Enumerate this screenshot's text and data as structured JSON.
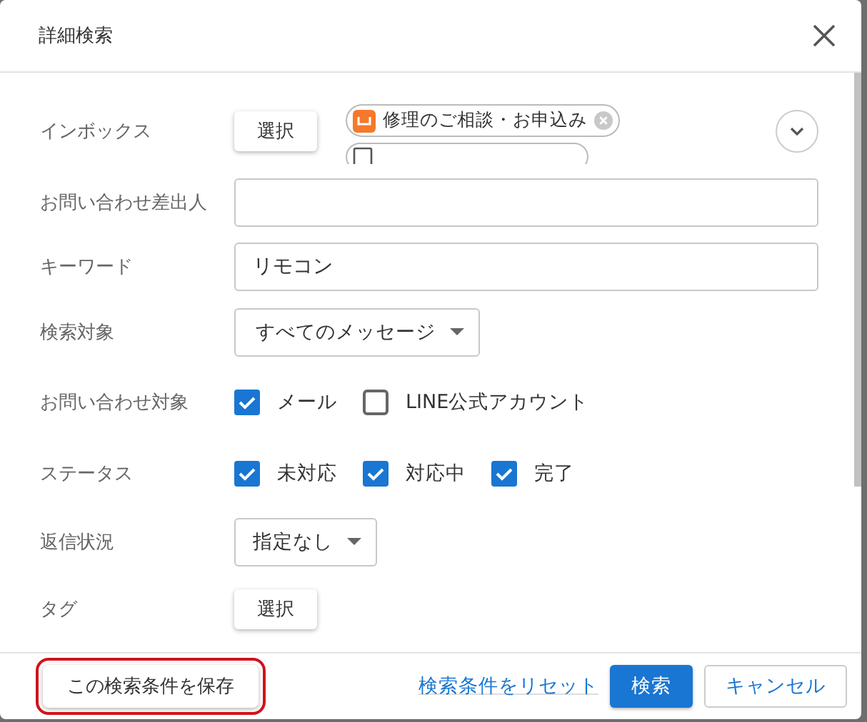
{
  "dialog": {
    "title": "詳細検索"
  },
  "inbox": {
    "label": "インボックス",
    "button": "選択",
    "chips": [
      {
        "label": "修理のご相談・お申込み",
        "kind": "orange"
      },
      {
        "kind": "clipped"
      }
    ],
    "expanded": false
  },
  "sender": {
    "label": "お問い合わせ差出人"
  },
  "keyword": {
    "label": "キーワード",
    "value": "リモコン"
  },
  "target": {
    "label": "検索対象",
    "value": "すべてのメッセージ"
  },
  "channel": {
    "label": "お問い合わせ対象",
    "options": [
      {
        "label": "メール",
        "checked": true
      },
      {
        "label": "LINE公式アカウント",
        "checked": false
      }
    ]
  },
  "status": {
    "label": "ステータス",
    "options": [
      {
        "label": "未対応",
        "checked": true
      },
      {
        "label": "対応中",
        "checked": true
      },
      {
        "label": "完了",
        "checked": true
      }
    ]
  },
  "reply": {
    "label": "返信状況",
    "value": "指定なし"
  },
  "tag": {
    "label": "タグ",
    "button": "選択"
  },
  "footer": {
    "save": "この検索条件を保存",
    "save_highlighted": true,
    "reset": "検索条件をリセット",
    "search": "検索",
    "cancel": "キャンセル"
  }
}
